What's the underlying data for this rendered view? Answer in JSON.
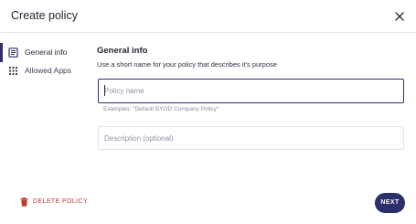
{
  "dialog": {
    "title": "Create policy",
    "close_icon": "close-icon"
  },
  "sidebar": {
    "items": [
      {
        "label": "General info",
        "icon": "document-icon",
        "active": true
      },
      {
        "label": "Allowed Apps",
        "icon": "grid-icon",
        "active": false
      }
    ]
  },
  "main": {
    "section_title": "General info",
    "section_description": "Use a short name for your policy that describes it's purpose",
    "policy_name": {
      "placeholder": "Policy name",
      "value": "",
      "helper": "Examples: \"Default BYOD Company Policy\""
    },
    "description": {
      "placeholder": "Description (optional)",
      "value": ""
    }
  },
  "footer": {
    "delete_label": "DELETE POLICY",
    "next_label": "NEXT"
  },
  "colors": {
    "primary": "#2b2f6b",
    "danger": "#c0392b",
    "border": "#e3e4ea",
    "helper_text": "#8a8e9c"
  }
}
